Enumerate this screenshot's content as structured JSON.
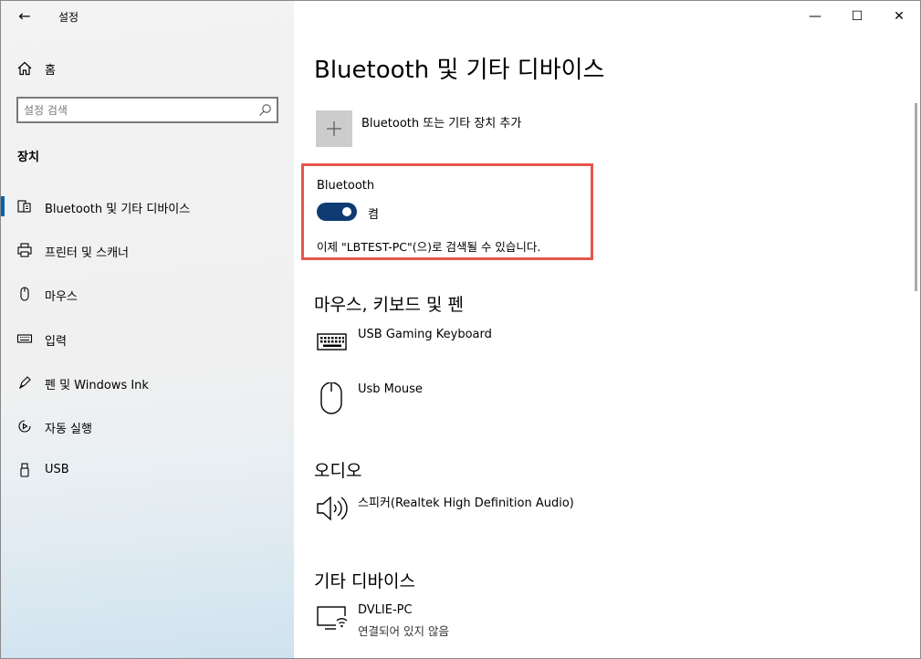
{
  "window": {
    "app_title": "설정",
    "back_glyph": "←",
    "minimize_glyph": "—",
    "maximize_glyph": "☐",
    "close_glyph": "✕"
  },
  "sidebar": {
    "home_label": "홈",
    "search_placeholder": "설정 검색",
    "section_label": "장치",
    "items": [
      {
        "label": "Bluetooth 및 기타 디바이스",
        "icon": "bluetooth-devices-icon",
        "selected": true
      },
      {
        "label": "프린터 및 스캐너",
        "icon": "printer-icon",
        "selected": false
      },
      {
        "label": "마우스",
        "icon": "mouse-icon",
        "selected": false
      },
      {
        "label": "입력",
        "icon": "keyboard-icon",
        "selected": false
      },
      {
        "label": "펜 및 Windows Ink",
        "icon": "pen-icon",
        "selected": false
      },
      {
        "label": "자동 실행",
        "icon": "autoplay-icon",
        "selected": false
      },
      {
        "label": "USB",
        "icon": "usb-icon",
        "selected": false
      }
    ]
  },
  "main": {
    "page_title": "Bluetooth 및 기타 디바이스",
    "add_device_label": "Bluetooth 또는 기타 장치 추가",
    "bluetooth": {
      "title": "Bluetooth",
      "state": "켬",
      "on": true,
      "discoverable_text": "이제 \"LBTEST-PC\"(으)로 검색될 수 있습니다."
    },
    "groups": {
      "input": {
        "title": "마우스, 키보드 및 펜",
        "devices": [
          {
            "name": "USB Gaming Keyboard",
            "icon": "keyboard-icon"
          },
          {
            "name": "Usb Mouse",
            "icon": "mouse-icon"
          }
        ]
      },
      "audio": {
        "title": "오디오",
        "devices": [
          {
            "name": "스피커(Realtek High Definition Audio)",
            "icon": "speaker-icon"
          }
        ]
      },
      "other": {
        "title": "기타 디바이스",
        "devices": [
          {
            "name": "DVLIE-PC",
            "status": "연결되어 있지 않음",
            "icon": "network-pc-icon"
          }
        ]
      }
    }
  },
  "colors": {
    "accent": "#0063b1",
    "toggle_on": "#0f3b73",
    "highlight_border": "#e8564a"
  }
}
